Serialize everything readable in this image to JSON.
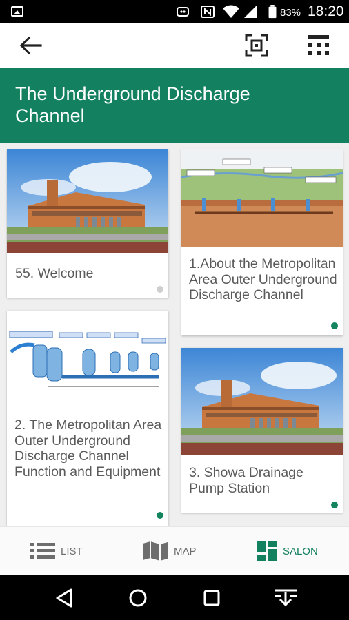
{
  "status_bar": {
    "battery_percent": "83%",
    "time": "18:20",
    "icons": [
      "image-icon",
      "notification-icon",
      "nfc-icon",
      "wifi-icon",
      "signal-icon",
      "battery-icon"
    ]
  },
  "app_bar": {
    "back_icon": "arrow-left-icon",
    "scan_icon": "qr-scan-icon",
    "grid_icon": "grid-menu-icon"
  },
  "title": "The Underground Discharge Channel",
  "cards": [
    {
      "label": "55. Welcome",
      "thumb": "building-photo",
      "dot_color": "#cfcfcf"
    },
    {
      "label": "1.About the Metropolitan Area Outer Underground Discharge Channel",
      "thumb": "cross-section-diagram",
      "dot_color": "#13845f"
    },
    {
      "label": "2. The Metropolitan Area Outer Underground Discharge Channel Function and Equipment",
      "thumb": "tanks-diagram",
      "dot_color": "#13845f"
    },
    {
      "label": "3. Showa Drainage Pump Station",
      "thumb": "building-photo",
      "dot_color": "#13845f"
    }
  ],
  "tabs": [
    {
      "label": "LIST",
      "icon": "list-icon",
      "active": false
    },
    {
      "label": "MAP",
      "icon": "map-icon",
      "active": false
    },
    {
      "label": "SALON",
      "icon": "salon-grid-icon",
      "active": true
    }
  ],
  "colors": {
    "brand_green": "#138060",
    "active_tab": "#138060",
    "inactive_tab": "#6d6d6d"
  },
  "nav_bar": [
    "back-triangle-icon",
    "home-circle-icon",
    "recents-square-icon",
    "download-icon"
  ]
}
